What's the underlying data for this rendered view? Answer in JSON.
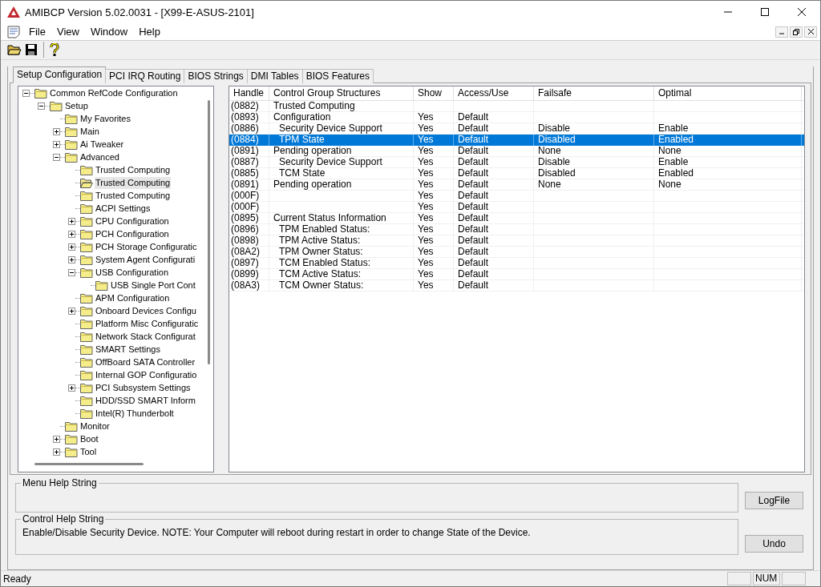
{
  "window": {
    "title": "AMIBCP Version 5.02.0031 - [X99-E-ASUS-2101]"
  },
  "menu": [
    "File",
    "View",
    "Window",
    "Help"
  ],
  "tabs": [
    {
      "label": "Setup Configuration",
      "selected": true
    },
    {
      "label": "PCI IRQ Routing",
      "selected": false
    },
    {
      "label": "BIOS Strings",
      "selected": false
    },
    {
      "label": "DMI Tables",
      "selected": false
    },
    {
      "label": "BIOS Features",
      "selected": false
    }
  ],
  "tree": [
    {
      "label": "Common RefCode Configuration",
      "expanded": true,
      "selected": false,
      "children": [
        {
          "label": "Setup",
          "expanded": true,
          "selected": false,
          "children": [
            {
              "label": "My Favorites",
              "selected": false
            },
            {
              "label": "Main",
              "expanded": false,
              "selected": false
            },
            {
              "label": "Ai Tweaker",
              "expanded": false,
              "selected": false
            },
            {
              "label": "Advanced",
              "expanded": true,
              "selected": false,
              "children": [
                {
                  "label": "Trusted Computing",
                  "selected": false
                },
                {
                  "label": "Trusted Computing",
                  "selected": true
                },
                {
                  "label": "Trusted Computing",
                  "selected": false
                },
                {
                  "label": "ACPI Settings",
                  "selected": false
                },
                {
                  "label": "CPU Configuration",
                  "expanded": false,
                  "selected": false
                },
                {
                  "label": "PCH Configuration",
                  "expanded": false,
                  "selected": false
                },
                {
                  "label": "PCH Storage Configuratic",
                  "expanded": false,
                  "selected": false
                },
                {
                  "label": "System Agent Configurati",
                  "expanded": false,
                  "selected": false
                },
                {
                  "label": "USB Configuration",
                  "expanded": true,
                  "selected": false,
                  "children": [
                    {
                      "label": "USB Single Port Cont",
                      "selected": false
                    }
                  ]
                },
                {
                  "label": "APM Configuration",
                  "selected": false
                },
                {
                  "label": "Onboard Devices Configu",
                  "expanded": false,
                  "selected": false
                },
                {
                  "label": "Platform Misc Configuratic",
                  "selected": false
                },
                {
                  "label": "Network Stack Configurat",
                  "selected": false
                },
                {
                  "label": "SMART Settings",
                  "selected": false
                },
                {
                  "label": "OffBoard SATA Controller",
                  "selected": false
                },
                {
                  "label": "Internal GOP Configuratio",
                  "selected": false
                },
                {
                  "label": "PCI Subsystem Settings",
                  "expanded": false,
                  "selected": false
                },
                {
                  "label": "HDD/SSD SMART Inform",
                  "selected": false
                },
                {
                  "label": "Intel(R) Thunderbolt",
                  "selected": false
                }
              ]
            },
            {
              "label": "Monitor",
              "selected": false
            },
            {
              "label": "Boot",
              "expanded": false,
              "selected": false
            },
            {
              "label": "Tool",
              "expanded": false,
              "selected": false
            }
          ]
        }
      ]
    }
  ],
  "table": {
    "columns": [
      "Handle",
      "Control Group Structures",
      "Show",
      "Access/Use",
      "Failsafe",
      "Optimal"
    ],
    "rows": [
      {
        "cells": [
          "(0882)",
          "Trusted Computing",
          null,
          null,
          null,
          null
        ],
        "indented": false,
        "selected": false
      },
      {
        "cells": [
          "(0893)",
          "Configuration",
          "Yes",
          "Default",
          null,
          null
        ],
        "indented": false,
        "selected": false
      },
      {
        "cells": [
          "(0886)",
          "Security Device Support",
          "Yes",
          "Default",
          "Disable",
          "Enable"
        ],
        "indented": true,
        "selected": false
      },
      {
        "cells": [
          "(0884)",
          "TPM State",
          "Yes",
          "Default",
          "Disabled",
          "Enabled"
        ],
        "indented": true,
        "selected": true
      },
      {
        "cells": [
          "(0891)",
          "Pending operation",
          "Yes",
          "Default",
          "None",
          "None"
        ],
        "indented": false,
        "selected": false
      },
      {
        "cells": [
          "(0887)",
          "Security Device Support",
          "Yes",
          "Default",
          "Disable",
          "Enable"
        ],
        "indented": true,
        "selected": false
      },
      {
        "cells": [
          "(0885)",
          "TCM State",
          "Yes",
          "Default",
          "Disabled",
          "Enabled"
        ],
        "indented": true,
        "selected": false
      },
      {
        "cells": [
          "(0891)",
          "Pending operation",
          "Yes",
          "Default",
          "None",
          "None"
        ],
        "indented": false,
        "selected": false
      },
      {
        "cells": [
          "(000F)",
          null,
          "Yes",
          "Default",
          null,
          null
        ],
        "selected": false
      },
      {
        "cells": [
          "(000F)",
          null,
          "Yes",
          "Default",
          null,
          null
        ],
        "selected": false
      },
      {
        "cells": [
          "(0895)",
          "Current Status Information",
          "Yes",
          "Default",
          null,
          null
        ],
        "indented": false,
        "selected": false
      },
      {
        "cells": [
          "(0896)",
          "TPM Enabled Status:",
          "Yes",
          "Default",
          null,
          null
        ],
        "indented": true,
        "selected": false
      },
      {
        "cells": [
          "(0898)",
          "TPM Active Status:",
          "Yes",
          "Default",
          null,
          null
        ],
        "indented": true,
        "selected": false
      },
      {
        "cells": [
          "(08A2)",
          "TPM Owner Status:",
          "Yes",
          "Default",
          null,
          null
        ],
        "indented": true,
        "selected": false
      },
      {
        "cells": [
          "(0897)",
          "TCM Enabled Status:",
          "Yes",
          "Default",
          null,
          null
        ],
        "indented": true,
        "selected": false
      },
      {
        "cells": [
          "(0899)",
          "TCM Active Status:",
          "Yes",
          "Default",
          null,
          null
        ],
        "indented": true,
        "selected": false
      },
      {
        "cells": [
          "(08A3)",
          "TCM Owner Status:",
          "Yes",
          "Default",
          null,
          null
        ],
        "indented": true,
        "selected": false
      }
    ]
  },
  "menu_help": {
    "label": "Menu Help String"
  },
  "control_help": {
    "label": "Control Help String",
    "text": "Enable/Disable Security Device. NOTE: Your Computer will reboot during restart in order to change State of the Device."
  },
  "buttons": [
    "LogFile",
    "Undo"
  ],
  "status_bar": {
    "text": "Ready",
    "num_indicator": "NUM"
  }
}
